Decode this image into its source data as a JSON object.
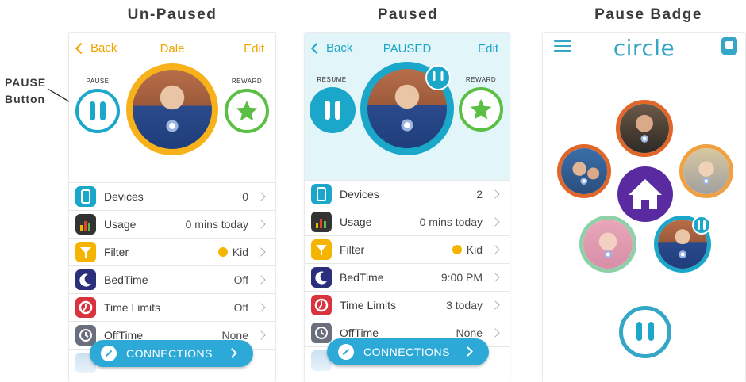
{
  "headings": {
    "unpaused": "Un-Paused",
    "paused": "Paused",
    "badge": "Pause Badge"
  },
  "callout": {
    "line1": "PAUSE",
    "line2": "Button"
  },
  "colors": {
    "accent_orange": "#f0a400",
    "accent_teal": "#1aa7c9",
    "reward_green": "#5bbf45",
    "connections_blue": "#2da9d8",
    "home_purple": "#5a2aa0"
  },
  "unpaused_screen": {
    "nav": {
      "back": "Back",
      "title": "Dale",
      "edit": "Edit"
    },
    "pause_label": "PAUSE",
    "reward_label": "REWARD",
    "rows": [
      {
        "icon": "devices-icon",
        "label": "Devices",
        "value": "0"
      },
      {
        "icon": "usage-icon",
        "label": "Usage",
        "value": "0 mins today"
      },
      {
        "icon": "filter-icon",
        "label": "Filter",
        "value": "Kid"
      },
      {
        "icon": "bedtime-icon",
        "label": "BedTime",
        "value": "Off"
      },
      {
        "icon": "time-limits-icon",
        "label": "Time Limits",
        "value": "Off"
      },
      {
        "icon": "offtime-icon",
        "label": "OffTime",
        "value": "None"
      }
    ],
    "connections": "CONNECTIONS"
  },
  "paused_screen": {
    "nav": {
      "back": "Back",
      "title": "PAUSED",
      "edit": "Edit"
    },
    "resume_label": "RESUME",
    "reward_label": "REWARD",
    "rows": [
      {
        "icon": "devices-icon",
        "label": "Devices",
        "value": "2"
      },
      {
        "icon": "usage-icon",
        "label": "Usage",
        "value": "0 mins today"
      },
      {
        "icon": "filter-icon",
        "label": "Filter",
        "value": "Kid"
      },
      {
        "icon": "bedtime-icon",
        "label": "BedTime",
        "value": "9:00 PM"
      },
      {
        "icon": "time-limits-icon",
        "label": "Time Limits",
        "value": "3 today"
      },
      {
        "icon": "offtime-icon",
        "label": "OffTime",
        "value": "None"
      }
    ],
    "connections": "CONNECTIONS"
  },
  "badge_screen": {
    "brand": "circle"
  }
}
